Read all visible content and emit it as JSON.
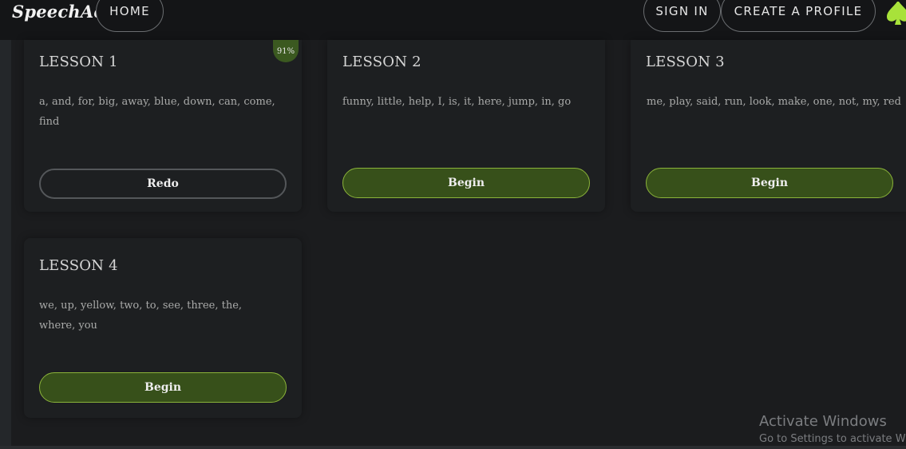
{
  "header": {
    "logo": "SpeechAce",
    "nav": {
      "home": "HOME",
      "sign_in": "SIGN IN",
      "create_profile": "CREATE A PROFILE"
    },
    "accent_color": "#a8e23a"
  },
  "lessons": [
    {
      "title": "LESSON 1",
      "words": "a, and, for, big, away, blue, down, can, come, find",
      "button": "Redo",
      "score": "91%"
    },
    {
      "title": "LESSON 2",
      "words": "funny, little, help, I, is, it, here, jump, in, go",
      "button": "Begin"
    },
    {
      "title": "LESSON 3",
      "words": "me, play, said, run, look, make, one, not, my, red",
      "button": "Begin"
    },
    {
      "title": "LESSON 4",
      "words": "we, up, yellow, two, to, see, three, the, where, you",
      "button": "Begin"
    }
  ],
  "colors": {
    "begin_button": "#37501a",
    "begin_border": "#8bb33a",
    "badge": "#3b5920",
    "background": "#1b1c1e"
  },
  "watermark": {
    "title": "Activate Windows",
    "subtitle": "Go to Settings to activate W"
  }
}
